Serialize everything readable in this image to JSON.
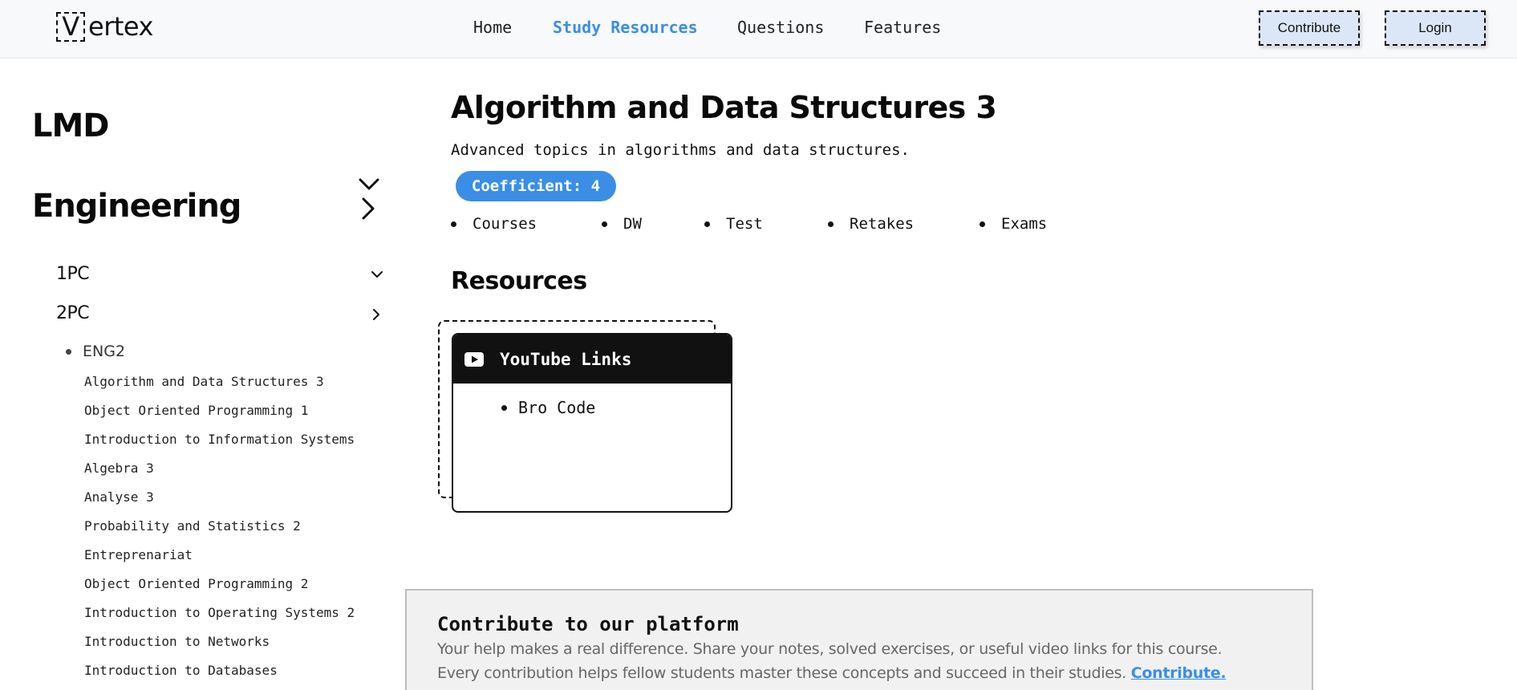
{
  "header": {
    "logo_letter": "V",
    "logo_rest": "ertex",
    "nav": [
      {
        "label": "Home",
        "active": false
      },
      {
        "label": "Study Resources",
        "active": true
      },
      {
        "label": "Questions",
        "active": false
      },
      {
        "label": "Features",
        "active": false
      }
    ],
    "contribute_label": "Contribute",
    "login_label": "Login"
  },
  "sidebar": {
    "sections": [
      {
        "label": "LMD",
        "expanded": true
      },
      {
        "label": "Engineering",
        "expanded": false
      }
    ],
    "years": [
      {
        "label": "1PC",
        "expanded": true
      },
      {
        "label": "2PC",
        "expanded": false
      }
    ],
    "group_label": "ENG2",
    "courses": [
      "Algorithm and Data Structures 3",
      "Object Oriented Programming 1",
      "Introduction to Information Systems",
      "Algebra 3",
      "Analyse 3",
      "Probability and Statistics 2",
      "Entreprenariat",
      "Object Oriented Programming 2",
      "Introduction to Operating Systems 2",
      "Introduction to Networks",
      "Introduction to Databases"
    ]
  },
  "main": {
    "title": "Algorithm and Data Structures 3",
    "description": "Advanced topics in algorithms and data structures.",
    "coefficient_label": "Coefficient: 4",
    "tabs": [
      "Courses",
      "DW",
      "Test",
      "Retakes",
      "Exams"
    ],
    "resources_heading": "Resources",
    "resource_card": {
      "icon": "youtube-icon",
      "title": "YouTube Links",
      "links": [
        "Bro Code"
      ]
    }
  },
  "contribute_panel": {
    "title": "Contribute to our platform",
    "line1": "Your help makes a real difference. Share your notes, solved exercises, or useful video links for this course.",
    "line2": "Every contribution helps fellow students master these concepts and succeed in their studies.",
    "link_label": "Contribute."
  },
  "colors": {
    "accent": "#3a8ee6",
    "header_bg": "#f8f9fa",
    "button_bg": "#dbe7f6",
    "card_header": "#111111",
    "panel_bg": "#f1f1f1"
  }
}
